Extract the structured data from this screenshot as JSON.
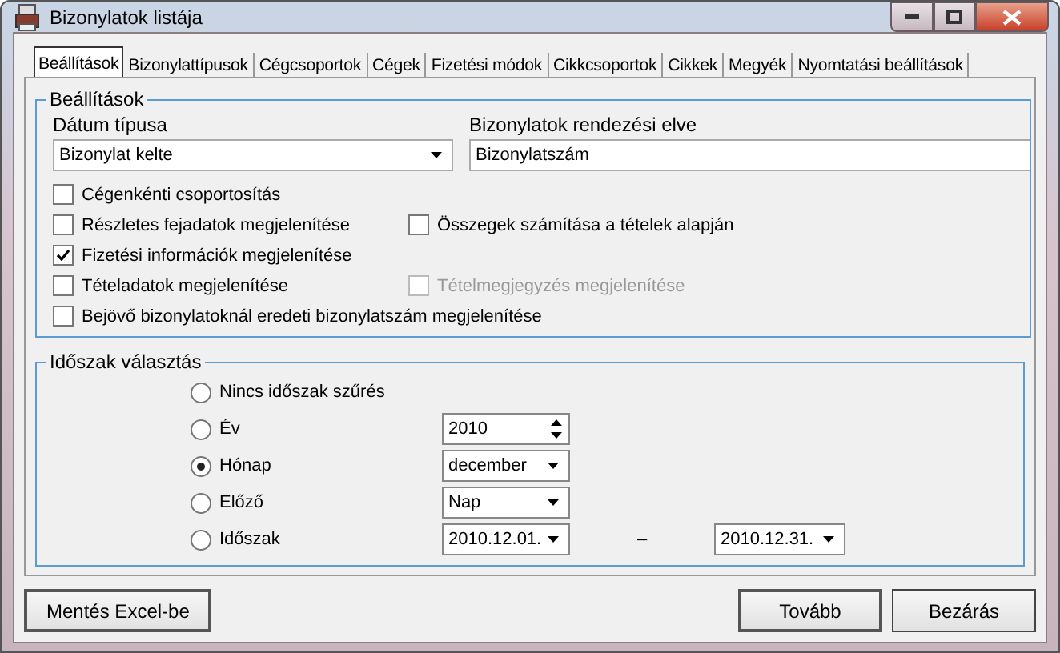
{
  "window": {
    "title": "Bizonylatok listája"
  },
  "tabs": [
    {
      "label": "Beállítások",
      "selected": true
    },
    {
      "label": "Bizonylattípusok",
      "selected": false
    },
    {
      "label": "Cégcsoportok",
      "selected": false
    },
    {
      "label": "Cégek",
      "selected": false
    },
    {
      "label": "Fizetési módok",
      "selected": false
    },
    {
      "label": "Cikkcsoportok",
      "selected": false
    },
    {
      "label": "Cikkek",
      "selected": false
    },
    {
      "label": "Megyék",
      "selected": false
    },
    {
      "label": "Nyomtatási beállítások",
      "selected": false
    }
  ],
  "settings": {
    "title": "Beállítások",
    "date_type": {
      "label": "Dátum típusa",
      "value": "Bizonylat kelte"
    },
    "sort_order": {
      "label": "Bizonylatok rendezési elve",
      "value": "Bizonylatszám"
    },
    "checkbox_rows": [
      [
        {
          "label": "Cégenkénti csoportosítás",
          "checked": false,
          "disabled": false
        }
      ],
      [
        {
          "label": "Részletes fejadatok megjelenítése",
          "checked": false,
          "disabled": false
        },
        {
          "label": "Összegek számítása a tételek alapján",
          "checked": false,
          "disabled": false
        }
      ],
      [
        {
          "label": "Fizetési információk megjelenítése",
          "checked": true,
          "disabled": false
        }
      ],
      [
        {
          "label": "Tételadatok megjelenítése",
          "checked": false,
          "disabled": false
        },
        {
          "label": "Tételmegjegyzés megjelenítése",
          "checked": false,
          "disabled": true
        }
      ],
      [
        {
          "label": "Bejövő bizonylatoknál eredeti bizonylatszám megjelenítése",
          "checked": false,
          "disabled": false
        }
      ]
    ]
  },
  "period": {
    "title": "Időszak választás",
    "options": [
      {
        "label": "Nincs időszak szűrés",
        "selected": false,
        "kind": "none"
      },
      {
        "label": "Év",
        "selected": false,
        "kind": "spin",
        "value": "2010"
      },
      {
        "label": "Hónap",
        "selected": true,
        "kind": "dropdown",
        "value": "december"
      },
      {
        "label": "Előző",
        "selected": false,
        "kind": "dropdown",
        "value": "Nap"
      },
      {
        "label": "Időszak",
        "selected": false,
        "kind": "range",
        "from": "2010.12.01.",
        "separator": "–",
        "to": "2010.12.31."
      }
    ]
  },
  "buttons": {
    "export": "Mentés Excel-be",
    "next": "Tovább",
    "close": "Bezárás"
  }
}
